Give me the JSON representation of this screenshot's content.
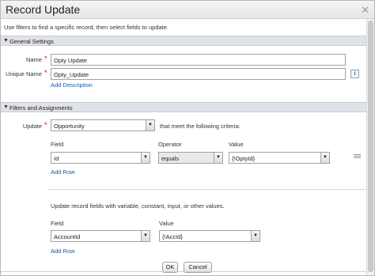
{
  "dialog": {
    "title": "Record Update",
    "intro": "Use filters to find a specific record, then select fields to update."
  },
  "general": {
    "section_label": "General Settings",
    "name_label": "Name",
    "name_value": "Opty Update",
    "unique_label": "Unique Name",
    "unique_value": "Opty_Update",
    "info_glyph": "i",
    "add_description": "Add Description"
  },
  "filters": {
    "section_label": "Filters and Assignments",
    "update_label": "Update",
    "update_value": "Opportunity",
    "criteria_text": "that meet the following criteria:",
    "col_field": "Field",
    "col_operator": "Operator",
    "col_value": "Value",
    "row": {
      "field": "Id",
      "operator": "equals",
      "value": "{!OptyId}"
    },
    "add_row": "Add Row"
  },
  "assign": {
    "description": "Update record fields with variable, constant, input, or other values.",
    "col_field": "Field",
    "col_value": "Value",
    "row": {
      "field": "AccountId",
      "value": "{!AccId}"
    },
    "add_row": "Add Row"
  },
  "buttons": {
    "ok": "OK",
    "cancel": "Cancel"
  },
  "icons": {
    "close": "close-icon",
    "collapse": "triangle-down-icon",
    "dropdown": "chevron-down-icon",
    "delete": "delete-row-icon"
  }
}
